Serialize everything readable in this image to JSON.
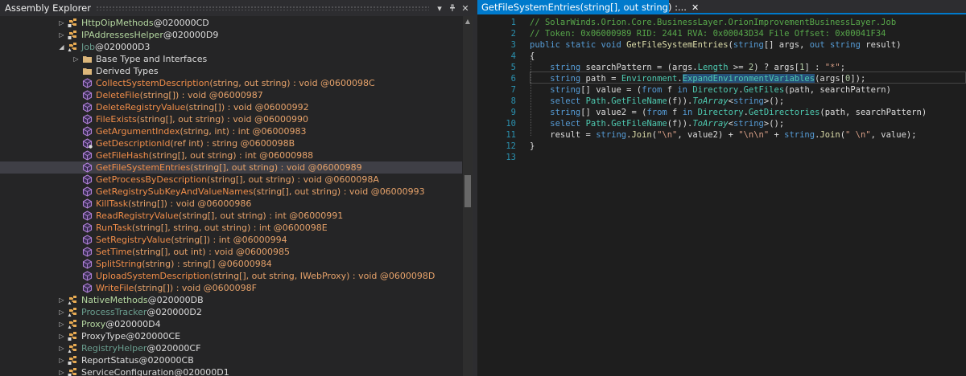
{
  "explorer": {
    "title": "Assembly Explorer",
    "menu_icon": "dropdown-arrow-icon",
    "pin_icon": "pin-icon",
    "close_icon": "close-icon",
    "rows": [
      {
        "indent": 72,
        "exp": "▷",
        "icon": "class-protected",
        "name": "HttpOipMethods",
        "sig": " @020000CD",
        "cls": "type"
      },
      {
        "indent": 72,
        "exp": "▷",
        "icon": "class-protected",
        "name": "IPAddressesHelper",
        "sig": " @020000D9",
        "cls": "type"
      },
      {
        "indent": 72,
        "exp": "◢",
        "icon": "class-internal",
        "name": "Job",
        "sig": " @020000D3",
        "cls": "dim"
      },
      {
        "indent": 90,
        "exp": "▷",
        "icon": "folder",
        "name": "Base Type and Interfaces",
        "sig": "",
        "cls": "normal"
      },
      {
        "indent": 90,
        "exp": "",
        "icon": "folder",
        "name": "Derived Types",
        "sig": "",
        "cls": "normal"
      },
      {
        "indent": 90,
        "exp": "",
        "icon": "method",
        "name": "CollectSystemDescription",
        "sig": "(string, out string) : void @0600098C",
        "cls": "method"
      },
      {
        "indent": 90,
        "exp": "",
        "icon": "method",
        "name": "DeleteFile",
        "sig": "(string[]) : void @06000987",
        "cls": "method"
      },
      {
        "indent": 90,
        "exp": "",
        "icon": "method",
        "name": "DeleteRegistryValue",
        "sig": "(string[]) : void @06000992",
        "cls": "method"
      },
      {
        "indent": 90,
        "exp": "",
        "icon": "method",
        "name": "FileExists",
        "sig": "(string[], out string) : void @06000990",
        "cls": "method"
      },
      {
        "indent": 90,
        "exp": "",
        "icon": "method",
        "name": "GetArgumentIndex",
        "sig": "(string, int) : int @06000983",
        "cls": "method"
      },
      {
        "indent": 90,
        "exp": "",
        "icon": "method-static",
        "name": "GetDescriptionId",
        "sig": "(ref int) : string @0600098B",
        "cls": "method"
      },
      {
        "indent": 90,
        "exp": "",
        "icon": "method",
        "name": "GetFileHash",
        "sig": "(string[], out string) : int @06000988",
        "cls": "method"
      },
      {
        "indent": 90,
        "exp": "",
        "icon": "method",
        "name": "GetFileSystemEntries",
        "sig": "(string[], out string) : void @06000989",
        "cls": "method",
        "selected": true
      },
      {
        "indent": 90,
        "exp": "",
        "icon": "method",
        "name": "GetProcessByDescription",
        "sig": "(string[], out string) : void @0600098A",
        "cls": "method"
      },
      {
        "indent": 90,
        "exp": "",
        "icon": "method",
        "name": "GetRegistrySubKeyAndValueNames",
        "sig": "(string[], out string) : void @06000993",
        "cls": "method"
      },
      {
        "indent": 90,
        "exp": "",
        "icon": "method",
        "name": "KillTask",
        "sig": "(string[]) : void @06000986",
        "cls": "method"
      },
      {
        "indent": 90,
        "exp": "",
        "icon": "method",
        "name": "ReadRegistryValue",
        "sig": "(string[], out string) : int @06000991",
        "cls": "method"
      },
      {
        "indent": 90,
        "exp": "",
        "icon": "method",
        "name": "RunTask",
        "sig": "(string[], string, out string) : int @0600098E",
        "cls": "method"
      },
      {
        "indent": 90,
        "exp": "",
        "icon": "method",
        "name": "SetRegistryValue",
        "sig": "(string[]) : int @06000994",
        "cls": "method"
      },
      {
        "indent": 90,
        "exp": "",
        "icon": "method",
        "name": "SetTime",
        "sig": "(string[], out int) : void @06000985",
        "cls": "method"
      },
      {
        "indent": 90,
        "exp": "",
        "icon": "method",
        "name": "SplitString",
        "sig": "(string) : string[] @06000984",
        "cls": "method"
      },
      {
        "indent": 90,
        "exp": "",
        "icon": "method",
        "name": "UploadSystemDescription",
        "sig": "(string[], out string, IWebProxy) : void @0600098D",
        "cls": "method"
      },
      {
        "indent": 90,
        "exp": "",
        "icon": "method",
        "name": "WriteFile",
        "sig": "(string[]) : void @0600098F",
        "cls": "method"
      },
      {
        "indent": 72,
        "exp": "▷",
        "icon": "class-internal",
        "name": "NativeMethods",
        "sig": " @020000DB",
        "cls": "type"
      },
      {
        "indent": 72,
        "exp": "▷",
        "icon": "class-internal",
        "name": "ProcessTracker",
        "sig": " @020000D2",
        "cls": "dim"
      },
      {
        "indent": 72,
        "exp": "▷",
        "icon": "class-internal",
        "name": "Proxy",
        "sig": " @020000D4",
        "cls": "type"
      },
      {
        "indent": 72,
        "exp": "▷",
        "icon": "class-protected",
        "name": "ProxyType",
        "sig": " @020000CE",
        "cls": "normal"
      },
      {
        "indent": 72,
        "exp": "▷",
        "icon": "class-internal",
        "name": "RegistryHelper",
        "sig": " @020000CF",
        "cls": "dim"
      },
      {
        "indent": 72,
        "exp": "▷",
        "icon": "class-protected",
        "name": "ReportStatus",
        "sig": " @020000CB",
        "cls": "normal"
      },
      {
        "indent": 72,
        "exp": "▷",
        "icon": "class-protected",
        "name": "ServiceConfiguration",
        "sig": " @020000D1",
        "cls": "normal"
      }
    ]
  },
  "editor": {
    "tab_label": "GetFileSystemEntries(string[], out string) :...",
    "tab_close": "✕",
    "colors": {
      "accent": "#007acc"
    },
    "lines": [
      {
        "n": "1",
        "tokens": [
          [
            "c-cm",
            "// SolarWinds.Orion.Core.BusinessLayer.OrionImprovementBusinessLayer.Job"
          ]
        ]
      },
      {
        "n": "2",
        "tokens": [
          [
            "c-cm",
            "// Token: 0x06000989 RID: 2441 RVA: 0x00043D34 File Offset: 0x00041F34"
          ]
        ]
      },
      {
        "n": "3",
        "tokens": [
          [
            "c-kw",
            "public static void "
          ],
          [
            "c-fn",
            "GetFileSystemEntries"
          ],
          [
            "",
            "("
          ],
          [
            "c-kw",
            "string"
          ],
          [
            "",
            "[] args, "
          ],
          [
            "c-kw",
            "out string"
          ],
          [
            "",
            " result)"
          ]
        ]
      },
      {
        "n": "4",
        "tokens": [
          [
            "",
            "{"
          ]
        ]
      },
      {
        "n": "5",
        "tokens": [
          [
            "",
            "    "
          ],
          [
            "c-kw",
            "string"
          ],
          [
            "",
            " searchPattern = (args."
          ],
          [
            "c-ty",
            "Length"
          ],
          [
            "",
            " >= "
          ],
          [
            "c-nm",
            "2"
          ],
          [
            "",
            ") ? args["
          ],
          [
            "c-nm",
            "1"
          ],
          [
            "",
            "] : "
          ],
          [
            "c-st",
            "\"*\""
          ],
          [
            "",
            ";"
          ]
        ]
      },
      {
        "n": "6",
        "tokens": [
          [
            "",
            "    "
          ],
          [
            "c-kw",
            "string"
          ],
          [
            "",
            " path = "
          ],
          [
            "c-ty",
            "Environment"
          ],
          [
            "",
            "."
          ],
          [
            "c-hl c-ty",
            "ExpandEnvironmentVariables"
          ],
          [
            "",
            "(args["
          ],
          [
            "c-nm",
            "0"
          ],
          [
            "",
            "]);"
          ]
        ]
      },
      {
        "n": "7",
        "tokens": [
          [
            "",
            "    "
          ],
          [
            "c-kw",
            "string"
          ],
          [
            "",
            "[] value = ("
          ],
          [
            "c-kw",
            "from"
          ],
          [
            "",
            " f "
          ],
          [
            "c-kw",
            "in"
          ],
          [
            "",
            " "
          ],
          [
            "c-ty",
            "Directory"
          ],
          [
            "",
            "."
          ],
          [
            "c-ty",
            "GetFiles"
          ],
          [
            "",
            "(path, searchPattern)"
          ]
        ]
      },
      {
        "n": "8",
        "tokens": [
          [
            "",
            "    "
          ],
          [
            "c-kw",
            "select"
          ],
          [
            "",
            " "
          ],
          [
            "c-ty",
            "Path"
          ],
          [
            "",
            "."
          ],
          [
            "c-ty",
            "GetFileName"
          ],
          [
            "",
            "(f))."
          ],
          [
            "c-it",
            "ToArray"
          ],
          [
            "",
            "<"
          ],
          [
            "c-kw",
            "string"
          ],
          [
            "",
            ">();"
          ]
        ]
      },
      {
        "n": "9",
        "tokens": [
          [
            "",
            "    "
          ],
          [
            "c-kw",
            "string"
          ],
          [
            "",
            "[] value2 = ("
          ],
          [
            "c-kw",
            "from"
          ],
          [
            "",
            " f "
          ],
          [
            "c-kw",
            "in"
          ],
          [
            "",
            " "
          ],
          [
            "c-ty",
            "Directory"
          ],
          [
            "",
            "."
          ],
          [
            "c-ty",
            "GetDirectories"
          ],
          [
            "",
            "(path, searchPattern)"
          ]
        ]
      },
      {
        "n": "10",
        "tokens": [
          [
            "",
            "    "
          ],
          [
            "c-kw",
            "select"
          ],
          [
            "",
            " "
          ],
          [
            "c-ty",
            "Path"
          ],
          [
            "",
            "."
          ],
          [
            "c-ty",
            "GetFileName"
          ],
          [
            "",
            "(f))."
          ],
          [
            "c-it",
            "ToArray"
          ],
          [
            "",
            "<"
          ],
          [
            "c-kw",
            "string"
          ],
          [
            "",
            ">();"
          ]
        ]
      },
      {
        "n": "11",
        "tokens": [
          [
            "",
            "    result = "
          ],
          [
            "c-kw",
            "string"
          ],
          [
            "",
            "."
          ],
          [
            "c-fn",
            "Join"
          ],
          [
            "",
            "("
          ],
          [
            "c-st",
            "\"\\n\""
          ],
          [
            "",
            ", value2) + "
          ],
          [
            "c-st",
            "\"\\n\\n\""
          ],
          [
            "",
            " + "
          ],
          [
            "c-kw",
            "string"
          ],
          [
            "",
            "."
          ],
          [
            "c-fn",
            "Join"
          ],
          [
            "",
            "("
          ],
          [
            "c-st",
            "\" \\n\""
          ],
          [
            "",
            ", value);"
          ]
        ]
      },
      {
        "n": "12",
        "tokens": [
          [
            "",
            "}"
          ]
        ]
      },
      {
        "n": "13",
        "tokens": [
          [
            "",
            ""
          ]
        ]
      }
    ]
  }
}
